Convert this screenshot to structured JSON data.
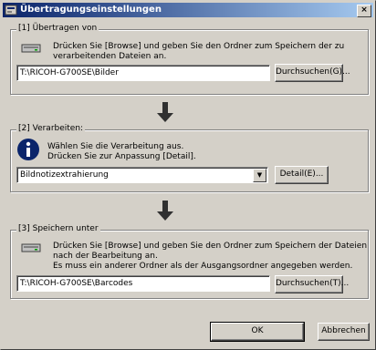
{
  "window": {
    "title": "Übertragungseinstellungen",
    "close": "×"
  },
  "transfer_from": {
    "label": "[1] Übertragen von",
    "description": [
      "Drücken Sie [Browse] und geben Sie den Ordner zum Speichern der zu",
      "verarbeitenden Dateien an."
    ],
    "path": "T:\\RICOH-G700SE\\Bilder",
    "browse": "Durchsuchen(G)..."
  },
  "process": {
    "label": "[2] Verarbeiten:",
    "description": [
      "Wählen Sie die Verarbeitung aus.",
      "Drücken Sie zur Anpassung [Detail]."
    ],
    "selected": "Bildnotizextrahierung",
    "dropdown": "▼",
    "detail": "Detail(E)..."
  },
  "save_to": {
    "label": "[3] Speichern unter",
    "description": [
      "Drücken Sie [Browse] und geben Sie den Ordner zum Speichern der Dateien",
      "nach der Bearbeitung an.",
      "Es muss ein anderer Ordner als der Ausgangsordner angegeben werden."
    ],
    "path": "T:\\RICOH-G700SE\\Barcodes",
    "browse": "Durchsuchen(T)..."
  },
  "footer": {
    "ok": "OK",
    "cancel": "Abbrechen"
  }
}
